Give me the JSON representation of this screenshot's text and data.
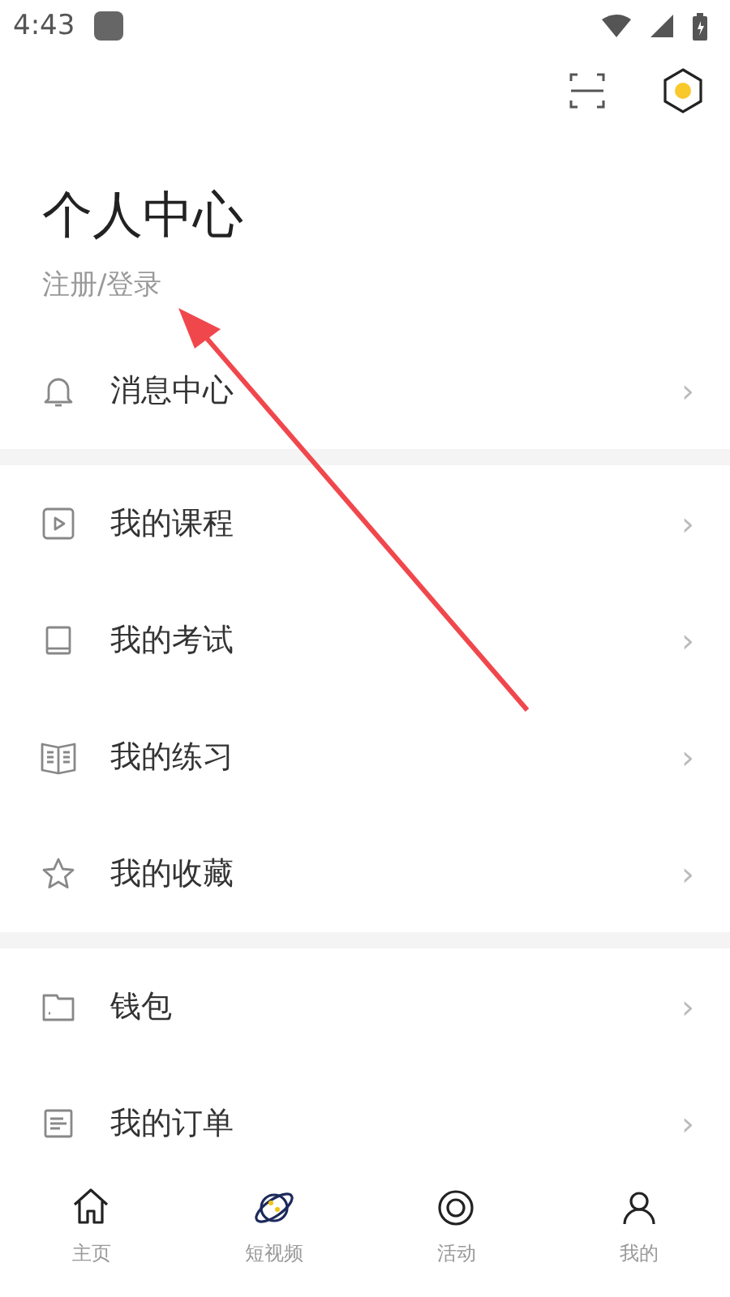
{
  "status_bar": {
    "time": "4:43"
  },
  "header": {
    "title": "个人中心",
    "login_link": "注册/登录"
  },
  "menu_groups": [
    {
      "items": [
        {
          "label": "消息中心",
          "chevron": "›"
        }
      ]
    },
    {
      "items": [
        {
          "label": "我的课程",
          "chevron": "›"
        },
        {
          "label": "我的考试",
          "chevron": "›"
        },
        {
          "label": "我的练习",
          "chevron": "›"
        },
        {
          "label": "我的收藏",
          "chevron": "›"
        }
      ]
    },
    {
      "items": [
        {
          "label": "钱包",
          "chevron": "›"
        },
        {
          "label": "我的订单",
          "chevron": "›"
        }
      ]
    }
  ],
  "tab_bar": [
    {
      "label": "主页"
    },
    {
      "label": "短视频"
    },
    {
      "label": "活动"
    },
    {
      "label": "我的"
    }
  ]
}
